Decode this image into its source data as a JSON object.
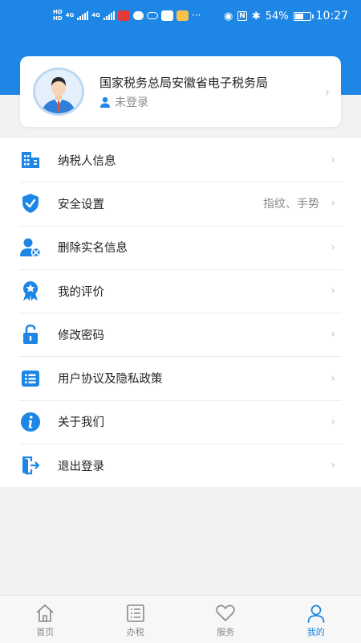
{
  "status_bar": {
    "hd1": "HD",
    "hd2": "HD",
    "net1": "4G",
    "net2": "4G",
    "more": "···",
    "battery": "54%",
    "time": "10:27",
    "bluetooth_glyph": "✱",
    "nfc_glyph": "N",
    "eye_glyph": "◉"
  },
  "profile": {
    "title": "国家税务总局安徽省电子税务局",
    "status": "未登录",
    "chevron": "›"
  },
  "menu": {
    "items": [
      {
        "label": "纳税人信息",
        "icon": "building-icon",
        "value": ""
      },
      {
        "label": "安全设置",
        "icon": "shield-check-icon",
        "value": "指纹、手势"
      },
      {
        "label": "删除实名信息",
        "icon": "user-remove-icon",
        "value": ""
      },
      {
        "label": "我的评价",
        "icon": "badge-star-icon",
        "value": ""
      },
      {
        "label": "修改密码",
        "icon": "lock-icon",
        "value": ""
      },
      {
        "label": "用户协议及隐私政策",
        "icon": "list-icon",
        "value": ""
      },
      {
        "label": "关于我们",
        "icon": "info-icon",
        "value": ""
      },
      {
        "label": "退出登录",
        "icon": "exit-door-icon",
        "value": ""
      }
    ],
    "chevron": "›"
  },
  "tabs": [
    {
      "label": "首页",
      "icon": "home-icon"
    },
    {
      "label": "办税",
      "icon": "list-doc-icon"
    },
    {
      "label": "服务",
      "icon": "heart-icon"
    },
    {
      "label": "我的",
      "icon": "person-icon"
    }
  ],
  "colors": {
    "primary": "#1e87e6",
    "background": "#f2f2f2",
    "text": "#222222",
    "muted": "#888888"
  }
}
